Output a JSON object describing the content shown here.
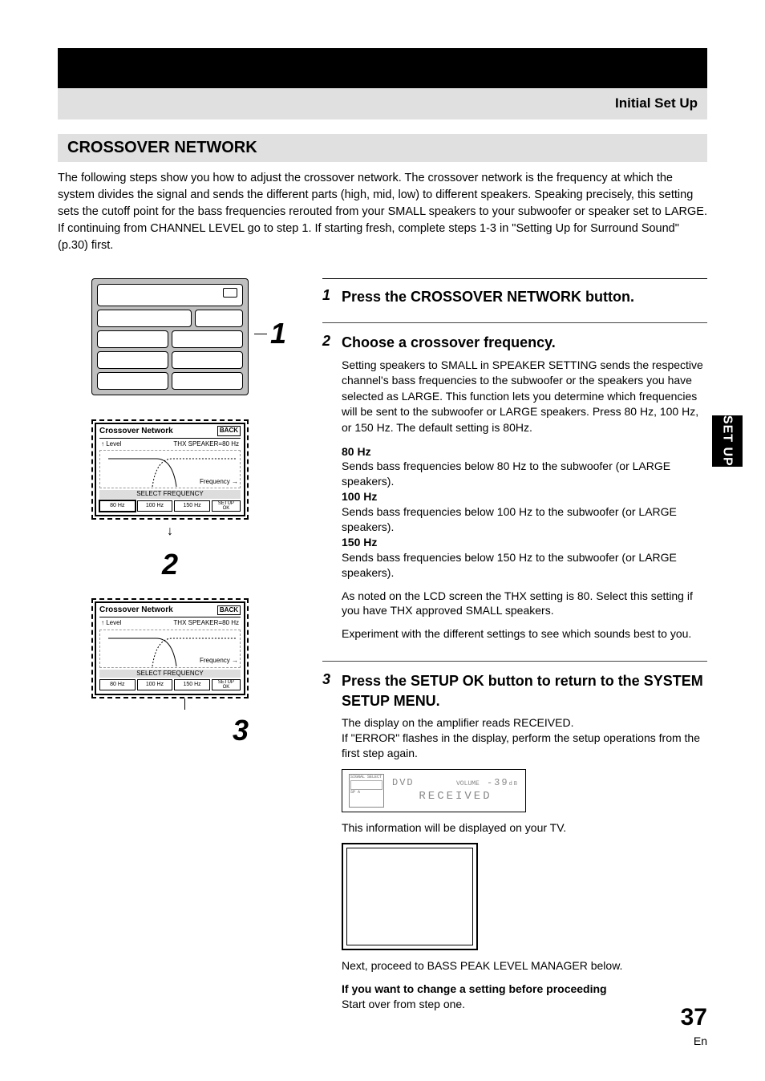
{
  "header": {
    "chapter": "Initial Set Up"
  },
  "section": {
    "title": "CROSSOVER NETWORK"
  },
  "intro": "The following steps show you how to adjust the crossover network. The crossover network is the frequency at which the system divides the signal and sends the different parts (high, mid, low) to different speakers. Speaking precisely, this setting sets the cutoff point for the bass frequencies rerouted from your SMALL speakers to your subwoofer or speaker set to LARGE. If continuing from CHANNEL LEVEL go to step 1. If starting fresh, complete steps 1-3 in \"Setting Up for Surround Sound\" (p.30) first.",
  "callouts": {
    "c1": "1",
    "c2": "2",
    "c3": "3"
  },
  "lcd": {
    "title": "Crossover Network",
    "back": "BACK",
    "level": "Level",
    "thx": "THX SPEAKER=80 Hz",
    "frequency": "Frequency",
    "select": "SELECT FREQUENCY",
    "b80": "80 Hz",
    "b100": "100 Hz",
    "b150": "150 Hz",
    "setup": "SETUP",
    "ok": "OK"
  },
  "steps": {
    "s1": {
      "num": "1",
      "title": "Press the CROSSOVER NETWORK button."
    },
    "s2": {
      "num": "2",
      "title": "Choose a crossover frequency.",
      "body": "Setting speakers to SMALL in SPEAKER SETTING sends the respective channel's bass frequencies to the subwoofer or the speakers you have selected as LARGE. This function lets you determine which frequencies will be sent to the subwoofer or LARGE speakers. Press 80 Hz, 100 Hz, or 150 Hz. The default setting is 80Hz.",
      "f80_t": "80 Hz",
      "f80_b": "Sends bass frequencies below 80 Hz to the subwoofer (or LARGE speakers).",
      "f100_t": "100 Hz",
      "f100_b": "Sends bass frequencies below 100 Hz to the subwoofer (or LARGE speakers).",
      "f150_t": "150 Hz",
      "f150_b": "Sends bass frequencies below 150 Hz to the subwoofer (or LARGE speakers).",
      "note1": "As noted on the LCD screen the THX setting is 80. Select this setting if you have THX approved SMALL speakers.",
      "note2": "Experiment with the different settings to see which sounds best to you."
    },
    "s3": {
      "num": "3",
      "title": "Press the SETUP OK button to return to the SYSTEM SETUP MENU.",
      "line1": "The display on the amplifier reads RECEIVED.",
      "line2": "If \"ERROR\" flashes in the display, perform the setup operations from the first step again.",
      "tv_note": "This information will be displayed on your TV.",
      "next": "Next, proceed to BASS PEAK LEVEL MANAGER below.",
      "change_t": "If you want to change a setting before proceeding",
      "change_b": "Start over from step one."
    }
  },
  "amp": {
    "signal": "SIGNAL SELECT",
    "spa": "SP A",
    "source": "DVD",
    "vol_label": "VOLUME",
    "vol": "-39",
    "db": "dB",
    "status": "RECEIVED"
  },
  "side_tab": "SET UP",
  "footer": {
    "page": "37",
    "lang": "En"
  }
}
